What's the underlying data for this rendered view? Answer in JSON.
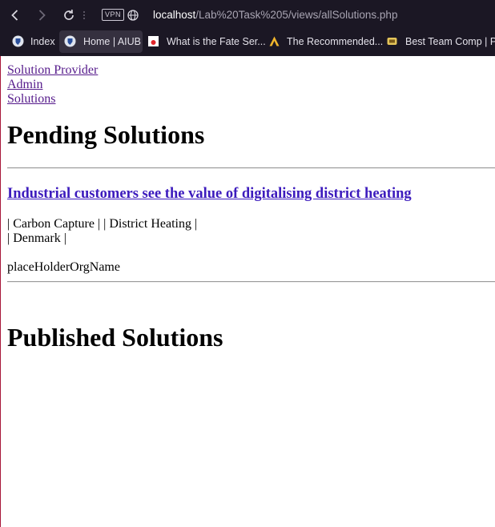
{
  "browser": {
    "vpn_label": "VPN",
    "url_host": "localhost",
    "url_path": "/Lab%20Task%205/views/allSolutions.php",
    "bookmarks": [
      {
        "label": "Index",
        "icon": "aiub-shield-icon"
      },
      {
        "label": "Home | AIUB",
        "icon": "aiub-shield-icon"
      },
      {
        "label": "What is the Fate Ser...",
        "icon": "red-dot-icon"
      },
      {
        "label": "The Recommended...",
        "icon": "triangle-logo-icon"
      },
      {
        "label": "Best Team Comp | P...",
        "icon": "emblem-icon"
      }
    ]
  },
  "nav": {
    "solution_provider": "Solution Provider",
    "admin": "Admin",
    "solutions": "Solutions"
  },
  "pending": {
    "heading": "Pending Solutions",
    "solutions": [
      {
        "title": "Industrial customers see the value of digitalising district heating",
        "tags_line": "| Carbon Capture | | District Heating |",
        "country_line": "| Denmark |",
        "org": "placeHolderOrgName"
      }
    ]
  },
  "published": {
    "heading": "Published Solutions"
  },
  "colors": {
    "chrome_bg": "#1b1724",
    "visited_link": "#551a8b",
    "title_link": "#3c1bbd"
  }
}
